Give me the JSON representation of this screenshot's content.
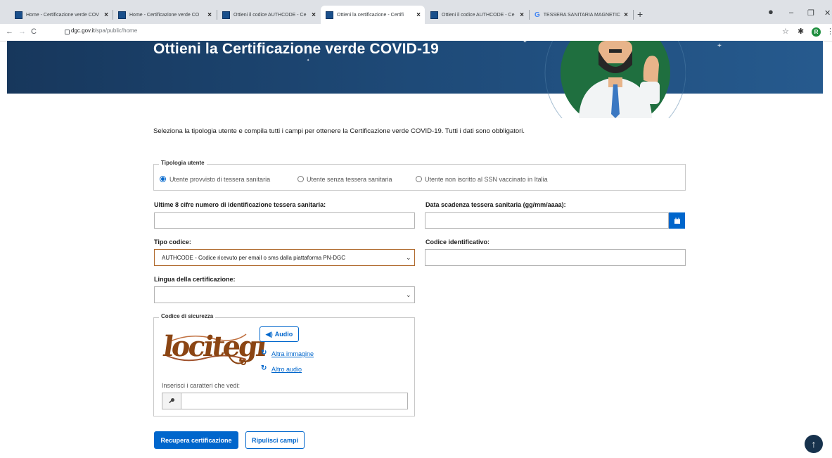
{
  "browser": {
    "tabs": [
      {
        "title": "Home - Certificazione verde COV",
        "icon": "pa-favicon"
      },
      {
        "title": "Home - Certificazione verde CO",
        "icon": "pa-favicon"
      },
      {
        "title": "Ottieni il codice AUTHCODE - Ce",
        "icon": "pa-favicon"
      },
      {
        "title": "Ottieni la certificazione - Certifi",
        "icon": "pa-favicon",
        "active": true
      },
      {
        "title": "Ottieni il codice AUTHCODE - Ce",
        "icon": "pa-favicon"
      },
      {
        "title": "TESSERA SANITARIA MAGNETIC",
        "icon": "google-favicon"
      }
    ],
    "new_tab": "+",
    "close": "×",
    "url_domain": "dgc.gov.it",
    "url_path": "/spa/public/home",
    "profile_initial": "R"
  },
  "header": {
    "title": "Ottieni la Certificazione verde COVID-19"
  },
  "intro": "Seleziona la tipologia utente e compila tutti i campi per ottenere la Certificazione verde COVID-19. Tutti i dati sono obbligatori.",
  "user_type": {
    "legend": "Tipologia utente",
    "options": [
      {
        "label": "Utente provvisto di tessera sanitaria",
        "selected": true
      },
      {
        "label": "Utente senza tessera sanitaria",
        "selected": false
      },
      {
        "label": "Utente non iscritto al SSN vaccinato in Italia",
        "selected": false
      }
    ]
  },
  "form": {
    "card_digits_label": "Ultime 8 cifre numero di identificazione tessera sanitaria:",
    "card_digits_value": "",
    "expiry_label": "Data scadenza tessera sanitaria (gg/mm/aaaa):",
    "expiry_value": "",
    "code_type_label": "Tipo codice:",
    "code_type_value": "AUTHCODE - Codice ricevuto per email o sms dalla piattaforma PN-DGC",
    "code_id_label": "Codice identificativo:",
    "code_id_value": "",
    "language_label": "Lingua della certificazione:",
    "language_value": ""
  },
  "captcha": {
    "legend": "Codice di sicurezza",
    "image_text": "locitegi",
    "audio_label": "Audio",
    "other_image": "Altra immagine",
    "other_audio": "Altro audio",
    "input_label": "Inserisci i caratteri che vedi:",
    "input_value": ""
  },
  "buttons": {
    "submit": "Recupera certificazione",
    "reset": "Ripulisci campi"
  },
  "colors": {
    "primary": "#0066cc",
    "banner": "#1e4a78"
  }
}
